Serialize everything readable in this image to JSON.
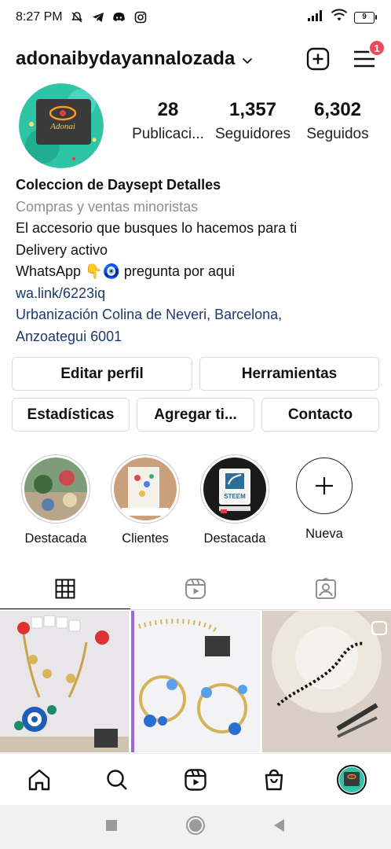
{
  "status_bar": {
    "time": "8:27 PM",
    "battery": "9",
    "left_icons": [
      "mute-icon",
      "telegram-icon",
      "discord-icon",
      "instagram-icon"
    ],
    "right_icons": [
      "signal-icon",
      "wifi-icon",
      "battery-icon"
    ]
  },
  "header": {
    "username": "adonaibydayannalozada",
    "notification_count": "1"
  },
  "profile": {
    "stats": [
      {
        "value": "28",
        "label": "Publicaci..."
      },
      {
        "value": "1,357",
        "label": "Seguidores"
      },
      {
        "value": "6,302",
        "label": "Seguidos"
      }
    ]
  },
  "bio": {
    "name": "Coleccion de Daysept Detalles",
    "category": "Compras y ventas minoristas",
    "line1": "El accesorio que busques lo hacemos para ti",
    "line2": "Delivery activo",
    "whatsapp_prefix": "WhatsApp",
    "whatsapp_emojis": "👇🧿",
    "whatsapp_suffix": "pregunta por aqui",
    "link": "wa.link/6223iq",
    "address_line1": "Urbanización Colina de Neveri, Barcelona,",
    "address_line2": "Anzoategui 6001"
  },
  "buttons": {
    "edit_profile": "Editar perfil",
    "tools": "Herramientas",
    "stats": "Estadísticas",
    "add": "Agregar ti...",
    "contact": "Contacto"
  },
  "highlights": [
    {
      "label": "Destacada"
    },
    {
      "label": "Clientes"
    },
    {
      "label": "Destacada",
      "image_text": "STEEM"
    },
    {
      "label": "Nueva"
    }
  ],
  "tabs": [
    "grid",
    "reels",
    "tagged"
  ],
  "colors": {
    "accent_red": "#ed4956",
    "link_blue": "#1d3a6b",
    "muted_gray": "#8e8e8e",
    "border": "#dbdbdb"
  }
}
